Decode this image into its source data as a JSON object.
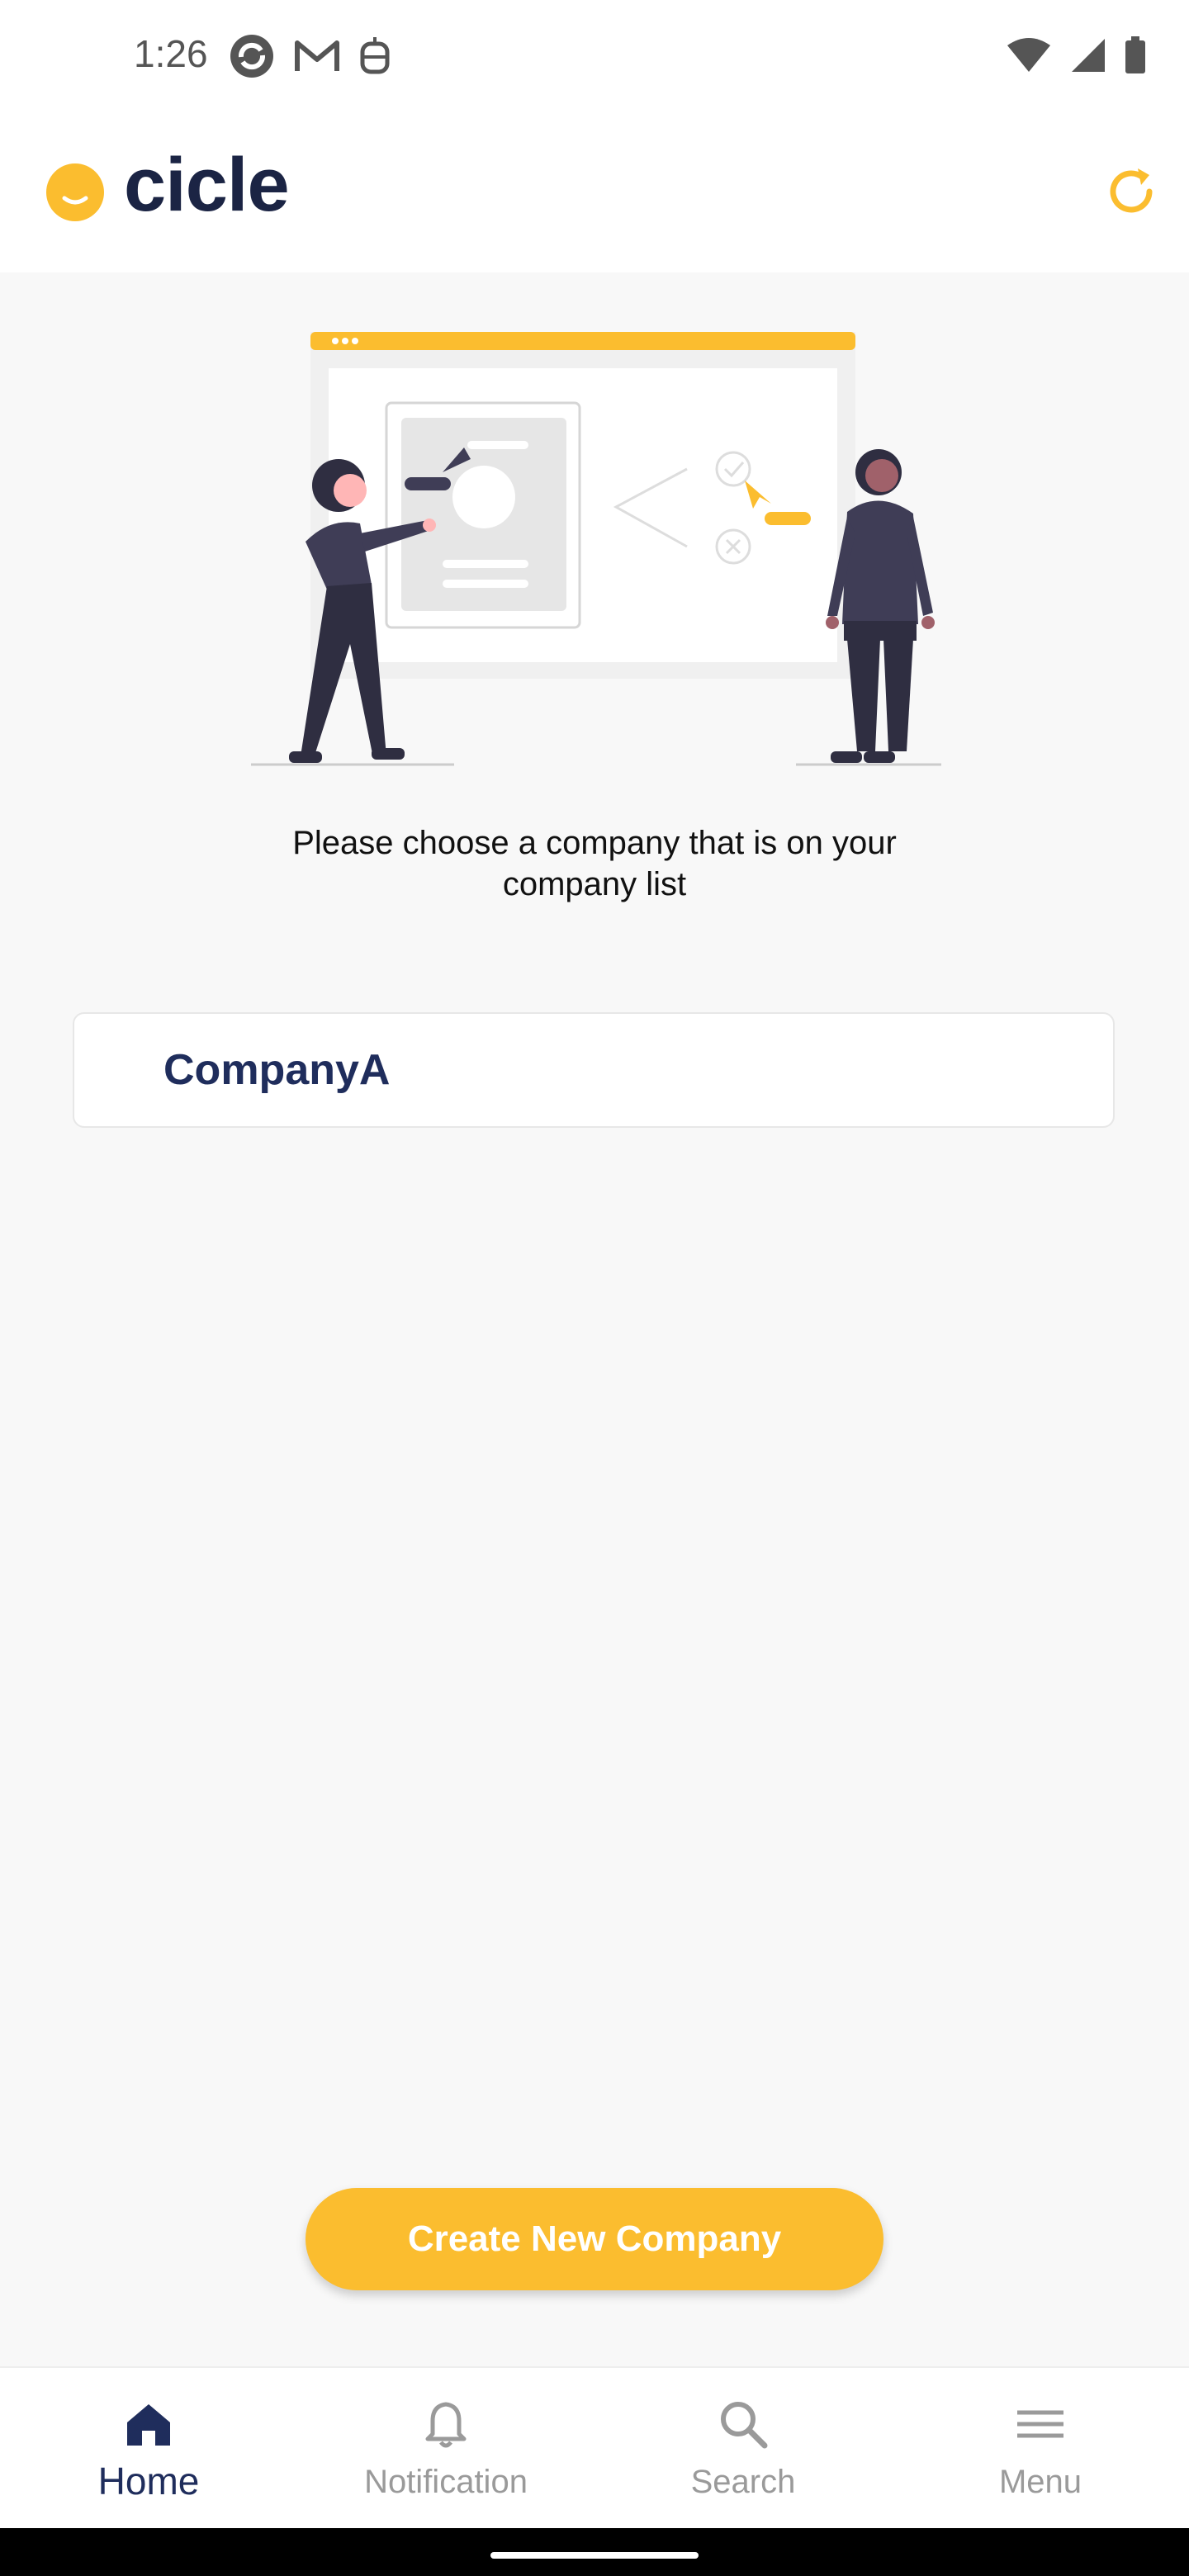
{
  "status_bar": {
    "time": "1:26"
  },
  "header": {
    "logo_text": "cicle"
  },
  "prompt": "Please choose a company that is on your company list",
  "companies": [
    {
      "name": "CompanyA"
    }
  ],
  "create_button": "Create New Company",
  "nav": {
    "items": [
      {
        "label": "Home",
        "icon": "home-icon",
        "active": true
      },
      {
        "label": "Notification",
        "icon": "bell-icon",
        "active": false
      },
      {
        "label": "Search",
        "icon": "search-icon",
        "active": false
      },
      {
        "label": "Menu",
        "icon": "menu-icon",
        "active": false
      }
    ]
  },
  "colors": {
    "accent": "#fbbd2f",
    "navy": "#1f2d5c",
    "background": "#f8f8f8"
  }
}
